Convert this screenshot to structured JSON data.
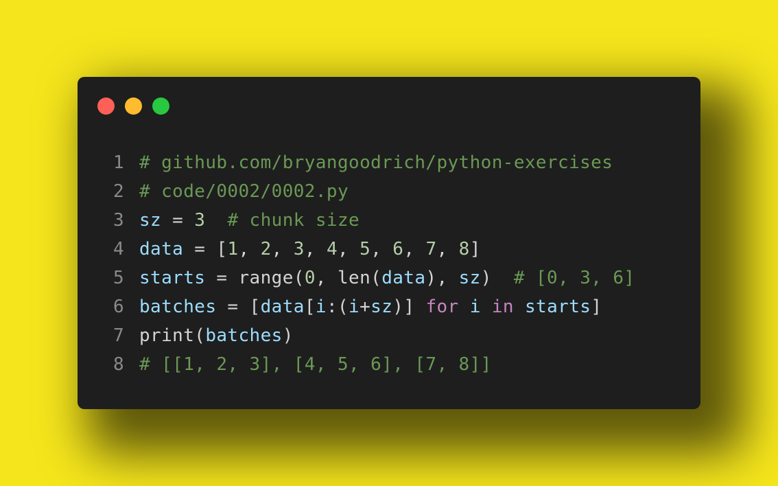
{
  "colors": {
    "background": "#f5e51c",
    "window_bg": "#1e1e1e",
    "close": "#fe5f57",
    "minimize": "#febc2e",
    "maximize": "#28c840",
    "line_number": "#8a8a8a",
    "comment": "#6a9955",
    "variable": "#9cdcfe",
    "plain": "#d4d4d4",
    "number": "#b5cea8",
    "keyword": "#c586c0"
  },
  "window": {
    "buttons": [
      {
        "name": "close",
        "icon": "circle-red"
      },
      {
        "name": "minimize",
        "icon": "circle-yellow"
      },
      {
        "name": "maximize",
        "icon": "circle-green"
      }
    ]
  },
  "code": {
    "language": "python",
    "lines": [
      {
        "number": "1",
        "tokens": [
          {
            "text": "# github.com/bryangoodrich/python-exercises",
            "type": "comment"
          }
        ]
      },
      {
        "number": "2",
        "tokens": [
          {
            "text": "# code/0002/0002.py",
            "type": "comment"
          }
        ]
      },
      {
        "number": "3",
        "tokens": [
          {
            "text": "sz",
            "type": "variable"
          },
          {
            "text": " = ",
            "type": "plain"
          },
          {
            "text": "3",
            "type": "number"
          },
          {
            "text": "  ",
            "type": "plain"
          },
          {
            "text": "# chunk size",
            "type": "comment"
          }
        ]
      },
      {
        "number": "4",
        "tokens": [
          {
            "text": "data",
            "type": "variable"
          },
          {
            "text": " = [",
            "type": "plain"
          },
          {
            "text": "1",
            "type": "number"
          },
          {
            "text": ", ",
            "type": "plain"
          },
          {
            "text": "2",
            "type": "number"
          },
          {
            "text": ", ",
            "type": "plain"
          },
          {
            "text": "3",
            "type": "number"
          },
          {
            "text": ", ",
            "type": "plain"
          },
          {
            "text": "4",
            "type": "number"
          },
          {
            "text": ", ",
            "type": "plain"
          },
          {
            "text": "5",
            "type": "number"
          },
          {
            "text": ", ",
            "type": "plain"
          },
          {
            "text": "6",
            "type": "number"
          },
          {
            "text": ", ",
            "type": "plain"
          },
          {
            "text": "7",
            "type": "number"
          },
          {
            "text": ", ",
            "type": "plain"
          },
          {
            "text": "8",
            "type": "number"
          },
          {
            "text": "]",
            "type": "plain"
          }
        ]
      },
      {
        "number": "5",
        "tokens": [
          {
            "text": "starts",
            "type": "variable"
          },
          {
            "text": " = range(",
            "type": "plain"
          },
          {
            "text": "0",
            "type": "number"
          },
          {
            "text": ", len(",
            "type": "plain"
          },
          {
            "text": "data",
            "type": "variable"
          },
          {
            "text": "), ",
            "type": "plain"
          },
          {
            "text": "sz",
            "type": "variable"
          },
          {
            "text": ")  ",
            "type": "plain"
          },
          {
            "text": "# [0, 3, 6]",
            "type": "comment"
          }
        ]
      },
      {
        "number": "6",
        "tokens": [
          {
            "text": "batches",
            "type": "variable"
          },
          {
            "text": " = [",
            "type": "plain"
          },
          {
            "text": "data",
            "type": "variable"
          },
          {
            "text": "[",
            "type": "plain"
          },
          {
            "text": "i",
            "type": "variable"
          },
          {
            "text": ":(",
            "type": "plain"
          },
          {
            "text": "i",
            "type": "variable"
          },
          {
            "text": "+",
            "type": "plain"
          },
          {
            "text": "sz",
            "type": "variable"
          },
          {
            "text": ")] ",
            "type": "plain"
          },
          {
            "text": "for",
            "type": "keyword"
          },
          {
            "text": " ",
            "type": "plain"
          },
          {
            "text": "i",
            "type": "variable"
          },
          {
            "text": " ",
            "type": "plain"
          },
          {
            "text": "in",
            "type": "keyword"
          },
          {
            "text": " ",
            "type": "plain"
          },
          {
            "text": "starts",
            "type": "variable"
          },
          {
            "text": "]",
            "type": "plain"
          }
        ]
      },
      {
        "number": "7",
        "tokens": [
          {
            "text": "print(",
            "type": "plain"
          },
          {
            "text": "batches",
            "type": "variable"
          },
          {
            "text": ")",
            "type": "plain"
          }
        ]
      },
      {
        "number": "8",
        "tokens": [
          {
            "text": "# [[1, 2, 3], [4, 5, 6], [7, 8]]",
            "type": "comment"
          }
        ]
      }
    ]
  }
}
